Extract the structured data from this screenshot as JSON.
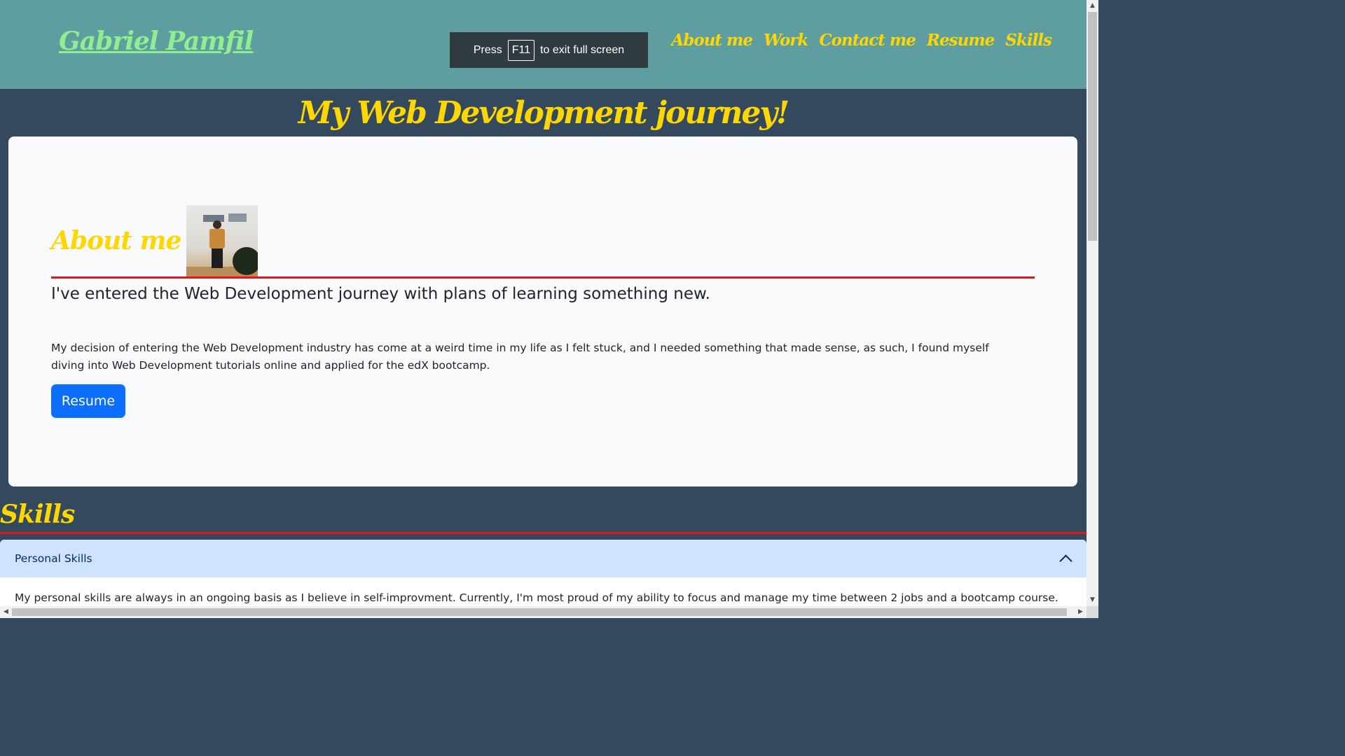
{
  "header": {
    "brand": "Gabriel Pamfil",
    "nav": [
      "About me",
      "Work",
      "Contact me",
      "Resume",
      "Skills"
    ]
  },
  "fullscreen_toast": {
    "press": "Press",
    "key": "F11",
    "suffix": "to exit full screen"
  },
  "main": {
    "title": "My Web Development journey!",
    "about": {
      "heading": "About me",
      "lead": "I've entered the Web Development journey with plans of learning something new.",
      "paragraph": "My decision of entering the Web Development industry has come at a weird time in my life as I felt stuck, and I needed something that made sense, as such, I found myself diving into Web Development tutorials online and applied for the edX bootcamp.",
      "resume_button": "Resume"
    },
    "skills": {
      "heading": "Skills",
      "accordion": {
        "title": "Personal Skills",
        "expanded": true,
        "body": "My personal skills are always in an ongoing basis as I believe in self-improvment. Currently, I'm most proud of my ability to focus and manage my time between 2 jobs and a bootcamp course."
      }
    }
  },
  "colors": {
    "header_bg": "#5f9ea0",
    "page_bg": "#34495e",
    "accent_yellow": "#ffd700",
    "brand_green": "#90ee90",
    "divider_red": "#e4151c",
    "button_blue": "#0d6efd",
    "accordion_header_bg": "#cfe2ff"
  }
}
